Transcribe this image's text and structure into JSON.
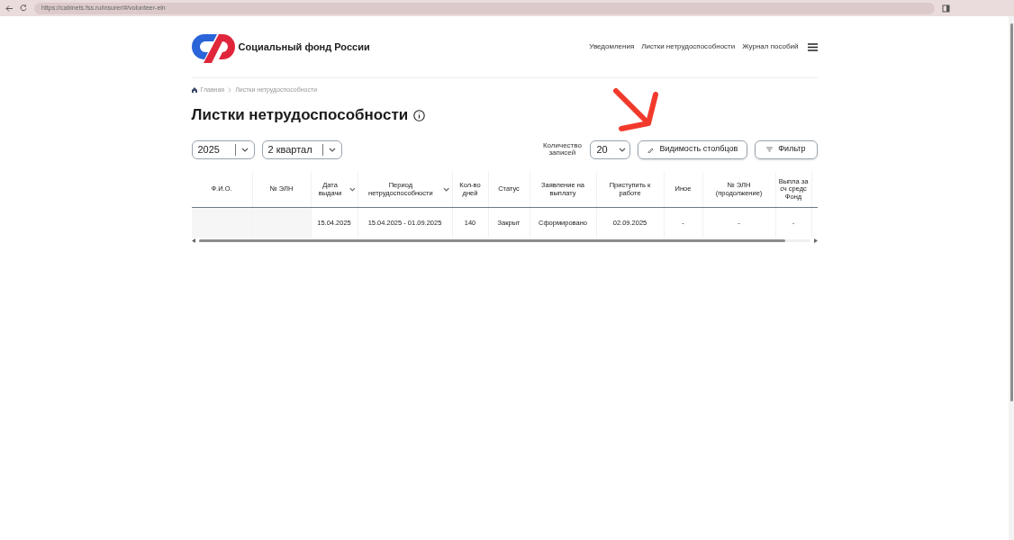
{
  "browser": {
    "url": "https://cabinets.fss.ru/insurer/#/volunteer-eln"
  },
  "header": {
    "brand": "Социальный фонд России",
    "nav": [
      "Уведомления",
      "Листки нетрудоспособности",
      "Журнал пособий"
    ]
  },
  "breadcrumbs": [
    "Главная",
    "Листки нетрудоспособности"
  ],
  "page_title": "Листки нетрудоспособности",
  "filters": {
    "year": "2025",
    "quarter": "2 квартал",
    "records_label": "Количество записей",
    "records": "20",
    "columns_button": "Видимость столбцов",
    "filter_button": "Фильтр"
  },
  "table": {
    "columns": [
      {
        "label": "Ф.И.О.",
        "sortable": false
      },
      {
        "label": "№ ЭЛН",
        "sortable": false
      },
      {
        "label": "Дата выдачи",
        "sortable": true
      },
      {
        "label": "Период нетрудоспособности",
        "sortable": true
      },
      {
        "label": "Кол-во дней",
        "sortable": false
      },
      {
        "label": "Статус",
        "sortable": false
      },
      {
        "label": "Заявление на выплату",
        "sortable": false
      },
      {
        "label": "Приступить к работе",
        "sortable": false
      },
      {
        "label": "Иное",
        "sortable": false
      },
      {
        "label": "№ ЭЛН (продолжение)",
        "sortable": false
      },
      {
        "label": "Выпла за сч средс Фонд",
        "sortable": false
      }
    ],
    "rows": [
      {
        "cells": [
          "",
          "",
          "15.04.2025",
          "15.04.2025 - 01.09.2025",
          "140",
          "Закрыт",
          "Сформировано",
          "02.09.2025",
          "-",
          "-",
          "-"
        ]
      }
    ]
  }
}
